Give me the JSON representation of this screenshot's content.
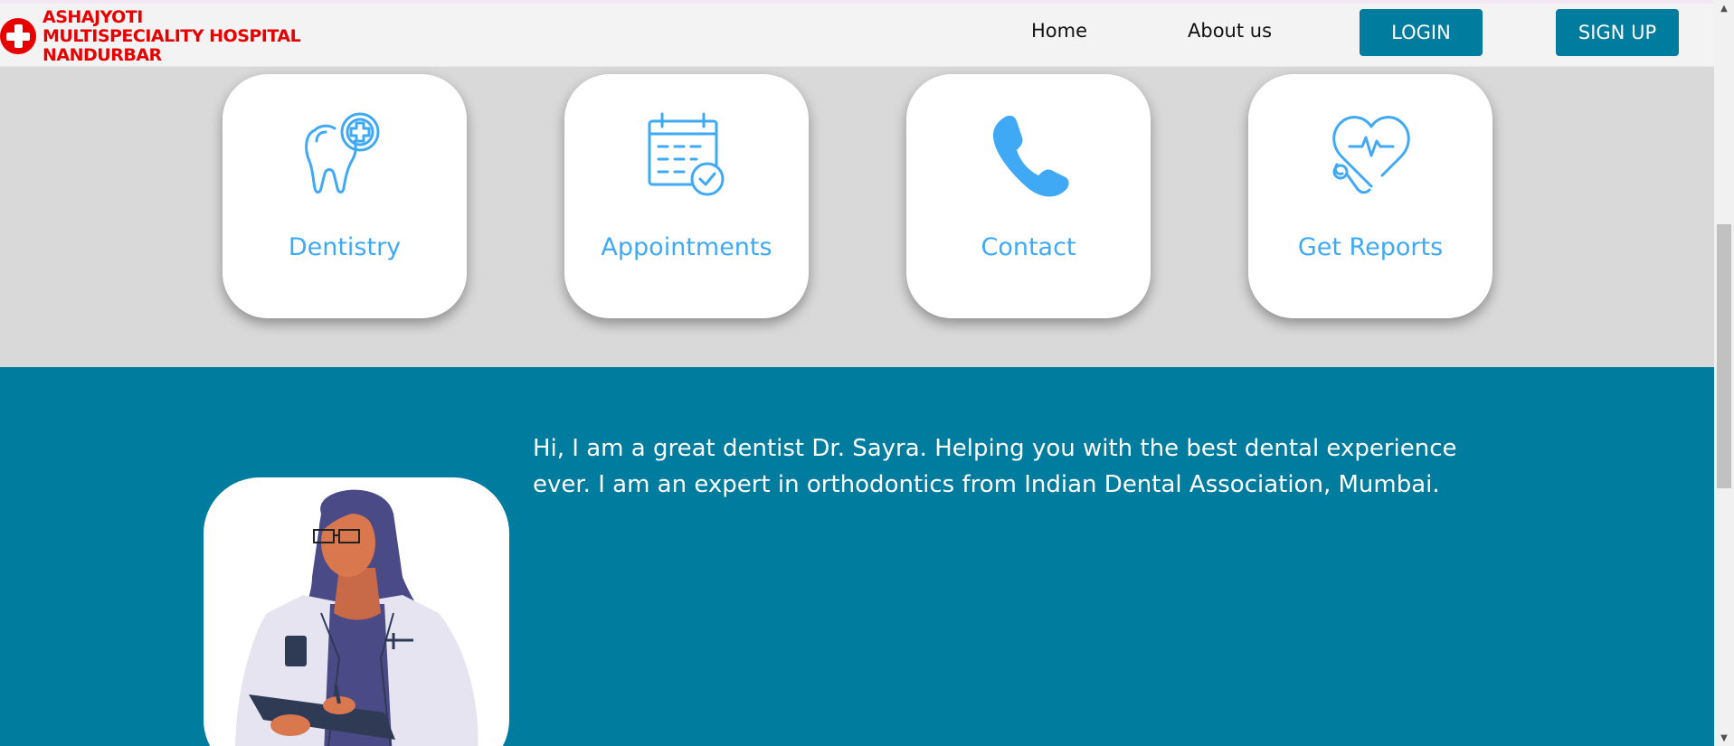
{
  "header": {
    "brand_name": "ASHAJYOTI MULTISPECIALITY HOSPITAL NANDURBAR",
    "brand_icon": "red-cross-icon",
    "nav": {
      "home": "Home",
      "about": "About us"
    },
    "buttons": {
      "login": "LOGIN",
      "signup": "SIGN UP"
    }
  },
  "services": [
    {
      "label": "Dentistry",
      "icon": "tooth-icon"
    },
    {
      "label": "Appointments",
      "icon": "calendar-icon"
    },
    {
      "label": "Contact",
      "icon": "phone-icon"
    },
    {
      "label": "Get Reports",
      "icon": "heart-stethoscope-icon"
    }
  ],
  "about": {
    "text": "Hi, I am a great dentist Dr. Sayra. Helping you with the best dental experience ever. I am an expert in orthodontics from Indian Dental Association, Mumbai.",
    "image": "doctor-illustration"
  },
  "colors": {
    "brand_red": "#e60000",
    "primary_teal": "#007c9e",
    "icon_blue": "#3fa9f5",
    "services_bg": "#d9d9d9"
  }
}
